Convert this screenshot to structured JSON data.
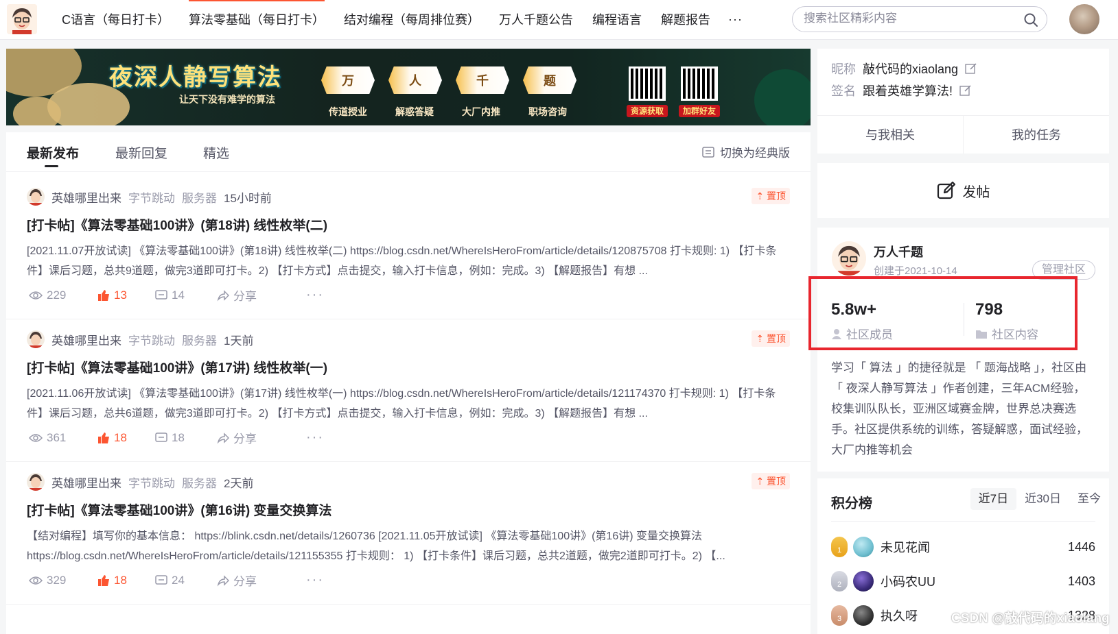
{
  "nav": {
    "items": [
      "C语言（每日打卡）",
      "算法零基础（每日打卡）",
      "结对编程（每周排位赛）",
      "万人千题公告",
      "编程语言",
      "解题报告"
    ],
    "more": "···",
    "search_placeholder": "搜索社区精彩内容"
  },
  "banner": {
    "title": "夜深人静写算法",
    "slogan": "让天下没有难学的算法",
    "badges": [
      "万",
      "人",
      "千",
      "题"
    ],
    "services": [
      "传道授业",
      "解惑答疑",
      "大厂内推",
      "职场咨询"
    ],
    "qr_labels": [
      "资源获取",
      "加群好友"
    ]
  },
  "feed": {
    "tabs": [
      "最新发布",
      "最新回复",
      "精选"
    ],
    "switch_label": "切换为经典版",
    "posts": [
      {
        "author": "英雄哪里出来",
        "tag1": "字节跳动",
        "tag2": "服务器",
        "time": "15小时前",
        "pin": "置顶",
        "title": "[打卡帖]《算法零基础100讲》(第18讲) 线性枚举(二)",
        "excerpt": "[2021.11.07开放试读] 《算法零基础100讲》(第18讲) 线性枚举(二) https://blog.csdn.net/WhereIsHeroFrom/article/details/120875708 打卡规则: 1) 【打卡条件】课后习题，总共9道题，做完3道即可打卡。2) 【打卡方式】点击提交，输入打卡信息，例如：完成。3) 【解题报告】有想 ...",
        "views": "229",
        "likes": "13",
        "comments": "14",
        "share": "分享"
      },
      {
        "author": "英雄哪里出来",
        "tag1": "字节跳动",
        "tag2": "服务器",
        "time": "1天前",
        "pin": "置顶",
        "title": "[打卡帖]《算法零基础100讲》(第17讲) 线性枚举(一)",
        "excerpt": "[2021.11.06开放试读] 《算法零基础100讲》(第17讲) 线性枚举(一) https://blog.csdn.net/WhereIsHeroFrom/article/details/121174370 打卡规则: 1) 【打卡条件】课后习题，总共6道题，做完3道即可打卡。2) 【打卡方式】点击提交，输入打卡信息，例如：完成。3) 【解题报告】有想 ...",
        "views": "361",
        "likes": "18",
        "comments": "18",
        "share": "分享"
      },
      {
        "author": "英雄哪里出来",
        "tag1": "字节跳动",
        "tag2": "服务器",
        "time": "2天前",
        "pin": "置顶",
        "title": "[打卡帖]《算法零基础100讲》(第16讲) 变量交换算法",
        "excerpt": "【结对编程】填写你的基本信息： https://blink.csdn.net/details/1260736 [2021.11.05开放试读] 《算法零基础100讲》(第16讲) 变量交换算法 https://blog.csdn.net/WhereIsHeroFrom/article/details/121155355 打卡规则： 1) 【打卡条件】课后习题，总共2道题，做完2道即可打卡。2) 【...",
        "views": "329",
        "likes": "18",
        "comments": "24",
        "share": "分享"
      }
    ]
  },
  "profile": {
    "nickname_label": "昵称",
    "nickname": "敲代码的xiaolang",
    "signature_label": "签名",
    "signature": "跟着英雄学算法!",
    "link_related": "与我相关",
    "link_tasks": "我的任务"
  },
  "post_button": "发帖",
  "community": {
    "name": "万人千题",
    "created": "创建于2021-10-14",
    "manage": "管理社区",
    "members_value": "5.8w+",
    "members_label": "社区成员",
    "content_value": "798",
    "content_label": "社区内容",
    "description": "学习「 算法 」的捷径就是 「 题海战略 」，社区由「 夜深人静写算法 」作者创建，三年ACM经验，校集训队队长，亚洲区域赛金牌，世界总决赛选手。社区提供系统的训练，答疑解惑，面试经验，大厂内推等机会"
  },
  "rank": {
    "title": "积分榜",
    "tabs": [
      "近7日",
      "近30日",
      "至今"
    ],
    "items": [
      {
        "medal": "1",
        "name": "未见花闻",
        "score": "1446"
      },
      {
        "medal": "2",
        "name": "小码农UU",
        "score": "1403"
      },
      {
        "medal": "3",
        "name": "执久呀",
        "score": "1328"
      }
    ]
  },
  "watermark": "CSDN @敲代码的xiaolang",
  "colors": {
    "accent": "#fc5531",
    "highlight_box": "#e8262e"
  }
}
